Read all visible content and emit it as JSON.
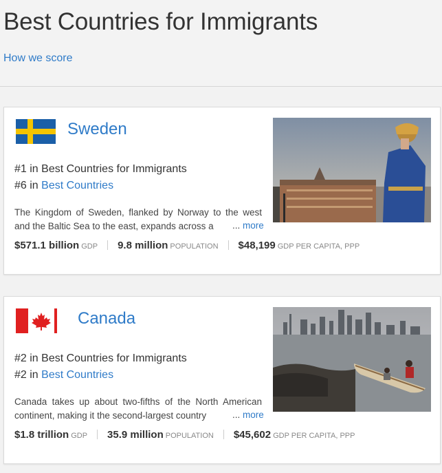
{
  "page": {
    "title": "Best Countries for Immigrants",
    "how_link": "How we score"
  },
  "colors": {
    "link": "#2f7bc8",
    "text": "#333333",
    "muted": "#888888"
  },
  "countries": [
    {
      "name": "Sweden",
      "flag_icon": "sweden-flag-icon",
      "rank_immigrants": "#1 in Best Countries for Immigrants",
      "rank_overall_prefix": "#6 in ",
      "rank_overall_link": "Best Countries",
      "description": "The Kingdom of Sweden, flanked by Norway to the west and the Baltic Sea to the east, expands across a",
      "more_ellipsis": "...",
      "more_link": "more",
      "gdp_value": "$571.1 billion",
      "gdp_label": "GDP",
      "population_value": "9.8 million",
      "population_label": "POPULATION",
      "per_capita_value": "$48,199",
      "per_capita_label": "GDP PER CAPITA, PPP",
      "photo_icon": "stockholm-royal-guard-photo"
    },
    {
      "name": "Canada",
      "flag_icon": "canada-flag-icon",
      "rank_immigrants": "#2 in Best Countries for Immigrants",
      "rank_overall_prefix": "#2 in ",
      "rank_overall_link": "Best Countries",
      "description": "Canada takes up about two-fifths of the North American continent, making it the second-largest country",
      "more_ellipsis": "...",
      "more_link": "more",
      "gdp_value": "$1.8 trillion",
      "gdp_label": "GDP",
      "population_value": "35.9 million",
      "population_label": "POPULATION",
      "per_capita_value": "$45,602",
      "per_capita_label": "GDP PER CAPITA, PPP",
      "photo_icon": "toronto-canoe-photo"
    }
  ]
}
